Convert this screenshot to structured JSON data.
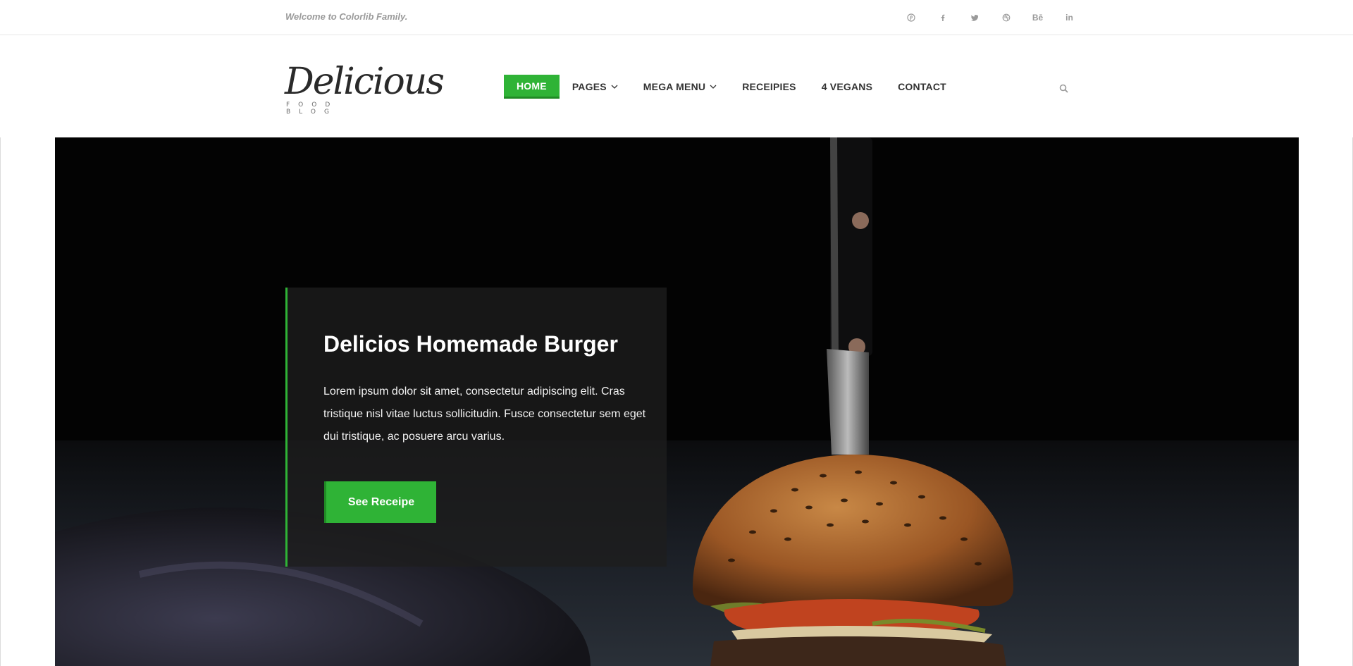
{
  "topbar": {
    "welcome": "Welcome to Colorlib Family.",
    "socials": [
      {
        "icon": "pinterest-icon"
      },
      {
        "icon": "facebook-icon"
      },
      {
        "icon": "twitter-icon"
      },
      {
        "icon": "dribbble-icon"
      },
      {
        "icon": "behance-icon",
        "label": "Bē"
      },
      {
        "icon": "linkedin-icon",
        "label": "in"
      }
    ]
  },
  "logo": {
    "word": "Delicious",
    "tag": "FOOD BLOG"
  },
  "nav": {
    "items": [
      {
        "label": "HOME",
        "active": true
      },
      {
        "label": "PAGES",
        "dropdown": true
      },
      {
        "label": "MEGA MENU",
        "dropdown": true
      },
      {
        "label": "RECEIPIES"
      },
      {
        "label": "4 VEGANS"
      },
      {
        "label": "CONTACT"
      }
    ],
    "search_icon": "search-icon"
  },
  "hero": {
    "title": "Delicios Homemade Burger",
    "text": "Lorem ipsum dolor sit amet, consectetur adipiscing elit. Cras tristique nisl vitae luctus sollicitudin. Fusce consectetur sem eget dui tristique, ac posuere arcu varius.",
    "cta_label": "See Receipe"
  },
  "colors": {
    "accent": "#2fb336",
    "accent_dark": "#208a25",
    "text_muted": "#9a9a9a"
  }
}
